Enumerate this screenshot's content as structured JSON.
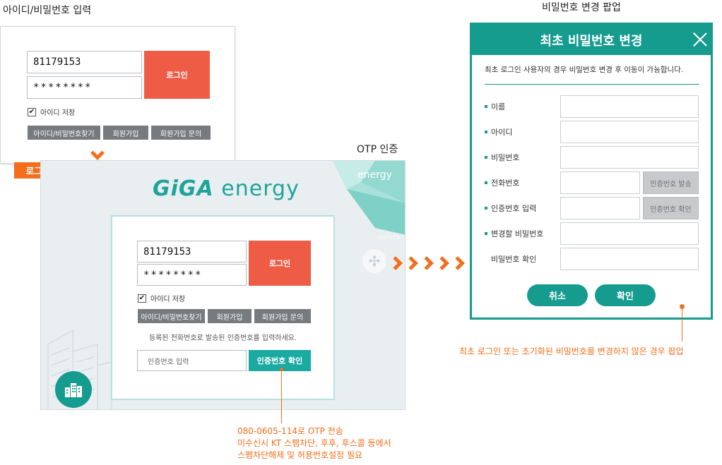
{
  "captions": {
    "login": "아이디/비밀번호 입력",
    "otp": "OTP 인증",
    "popup": "비밀번호 변경 팝업"
  },
  "login_screen": {
    "id_value": "81179153",
    "pw_value": "********",
    "login_label": "로그인",
    "save_id_label": "아이디 저장",
    "save_id_checked": true,
    "find_label": "아이디/비밀번호찾기",
    "join_label": "회원가입",
    "join_inquiry_label": "회원가입 문의"
  },
  "click_tag": "로그인 클릭",
  "otp_screen": {
    "logo_brand": "GiGA",
    "logo_word": "energy",
    "corner_text_1": "energy",
    "corner_text_2": "safety",
    "id_value": "81179153",
    "pw_value": "********",
    "login_label": "로그인",
    "save_id_label": "아이디 저장",
    "find_label": "아이디/비밀번호찾기",
    "join_label": "회원가입",
    "join_inquiry_label": "회원가입 문의",
    "instruction": "등록된 전화번호로 발송된 인증번호를 입력하세요.",
    "code_placeholder": "인증번호 입력",
    "confirm_label": "인증번호 확인"
  },
  "otp_note": {
    "line1": "080-0605-114로 OTP 전송",
    "line2": "미수신시 KT 스팸차단, 후후, 후스콜 등에서",
    "line3": "스팸차단해제 및 허용번호설정 필요"
  },
  "popup": {
    "title": "최초 비밀번호 변경",
    "description": "최초 로그인 사용자의 경우 비밀번호 변경 후 이동이 가능합니다.",
    "fields": [
      {
        "label": "이름"
      },
      {
        "label": "아이디"
      },
      {
        "label": "비밀번호"
      },
      {
        "label": "전화번호",
        "button": "인증번호 발송"
      },
      {
        "label": "인증번호 입력",
        "button": "인증번호 확인"
      },
      {
        "label": "변경할 비밀번호"
      },
      {
        "label": "비밀번호 확인"
      }
    ],
    "cancel_label": "취소",
    "ok_label": "확인"
  },
  "popup_note": "최초 로그인 또는 초기화된 비밀번호를 변경하지 않은 경우 팝업",
  "colors": {
    "accent_teal": "#169b8f",
    "login_red": "#ef5c46",
    "orange": "#f26e1b"
  }
}
